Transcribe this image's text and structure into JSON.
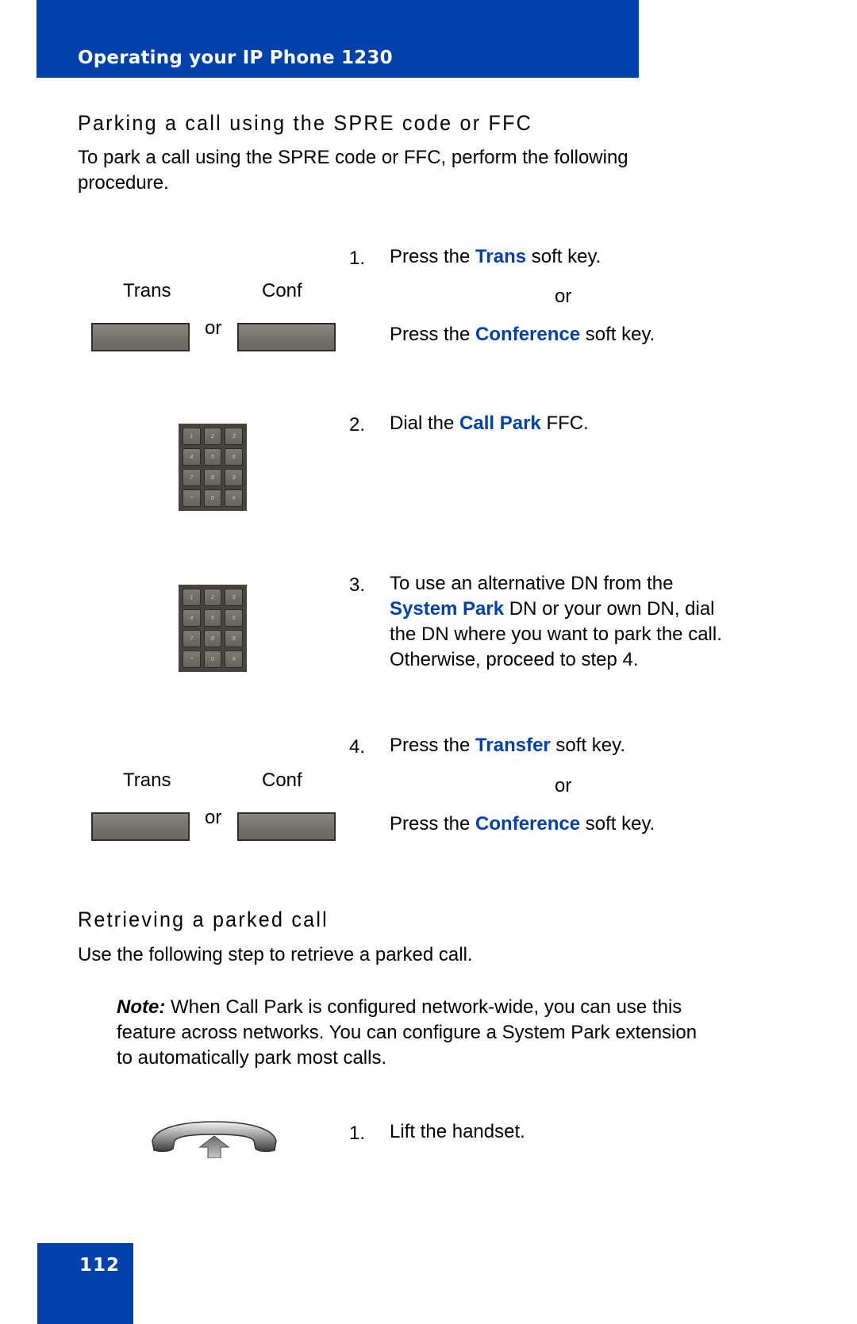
{
  "header": {
    "title": "Operating your IP Phone 1230"
  },
  "section1": {
    "heading": "Parking a call using the SPRE code or FFC",
    "intro_line1": "To park a call using the SPRE code or FFC, perform the following",
    "intro_line2": "procedure.",
    "softkeys": {
      "left_label": "Trans",
      "right_label": "Conf",
      "or": "or"
    },
    "keypad_keys": [
      "1",
      "2",
      "3",
      "4",
      "5",
      "6",
      "7",
      "8",
      "9",
      "*",
      "0",
      "#"
    ],
    "steps": [
      {
        "num": "1.",
        "pre": "Press the ",
        "kw": "Trans",
        "post": " soft key.",
        "or": "or",
        "alt_pre": "Press the ",
        "alt_kw": "Conference",
        "alt_post": " soft key."
      },
      {
        "num": "2.",
        "pre": "Dial the ",
        "kw": "Call Park",
        "post": " FFC."
      },
      {
        "num": "3.",
        "line1": "To use an alternative DN from the",
        "kw": "System Park",
        "line2_post": " DN or your own DN, dial",
        "line3": "the DN where you want to park the call.",
        "line4": "Otherwise, proceed to step 4."
      },
      {
        "num": "4.",
        "pre": "Press the ",
        "kw": "Transfer",
        "post": " soft key.",
        "or": "or",
        "alt_pre": "Press the ",
        "alt_kw": "Conference",
        "alt_post": " soft key."
      }
    ]
  },
  "section2": {
    "heading": "Retrieving a parked call",
    "intro": "Use the following step to retrieve a parked call.",
    "note_label": "Note:",
    "note_line1": " When Call Park is configured network-wide, you can use this",
    "note_line2": "feature across networks. You can configure a System Park extension",
    "note_line3": "to automatically park most calls.",
    "steps": [
      {
        "num": "1.",
        "text": "Lift the handset."
      }
    ]
  },
  "icons": {
    "softkey": "soft-key-icon",
    "keypad": "dialpad-icon",
    "handset": "lift-handset-icon"
  },
  "colors": {
    "brand_blue": "#0041ab",
    "softkey_gray": "#76726c"
  },
  "footer": {
    "page_number": "112"
  }
}
